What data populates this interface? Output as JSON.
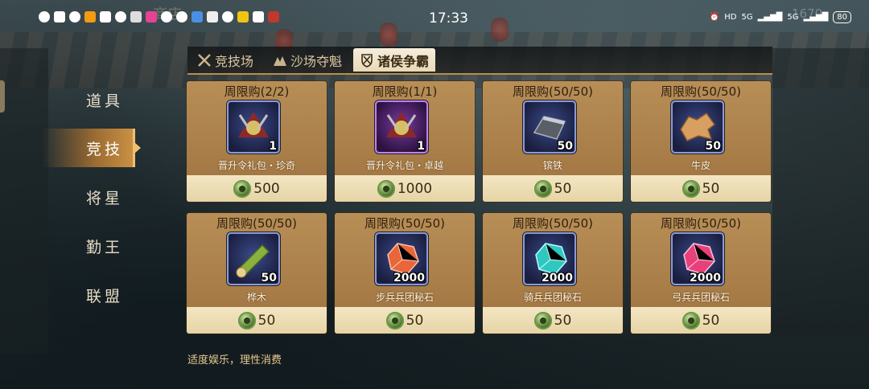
{
  "status_bar": {
    "time": "17:33",
    "battery": "80",
    "network": "5G",
    "signal_label": "HD",
    "faded_title": "商店",
    "faded_number": "1670"
  },
  "tabs": [
    {
      "label": "竞技场",
      "icon": "crossed-swords-icon",
      "active": false
    },
    {
      "label": "沙场夺魁",
      "icon": "mountain-banner-icon",
      "active": false
    },
    {
      "label": "诸侯争霸",
      "icon": "shield-swords-icon",
      "active": true
    }
  ],
  "nav": [
    {
      "label": "道具",
      "active": false
    },
    {
      "label": "竞技",
      "active": true
    },
    {
      "label": "将星",
      "active": false
    },
    {
      "label": "勤王",
      "active": false
    },
    {
      "label": "联盟",
      "active": false
    }
  ],
  "items": [
    {
      "limit": "周限购(2/2)",
      "name": "晋升令礼包・珍奇",
      "count": "1",
      "price": "500",
      "frame": "blue",
      "art": "gift-pack-icon"
    },
    {
      "limit": "周限购(1/1)",
      "name": "晋升令礼包・卓越",
      "count": "1",
      "price": "1000",
      "frame": "purple",
      "art": "gift-pack-icon"
    },
    {
      "limit": "周限购(50/50)",
      "name": "镔铁",
      "count": "50",
      "price": "50",
      "frame": "blue",
      "art": "iron-ingot-icon"
    },
    {
      "limit": "周限购(50/50)",
      "name": "牛皮",
      "count": "50",
      "price": "50",
      "frame": "blue",
      "art": "leather-hide-icon"
    },
    {
      "limit": "周限购(50/50)",
      "name": "桦木",
      "count": "50",
      "price": "50",
      "frame": "blue",
      "art": "birch-log-icon"
    },
    {
      "limit": "周限购(50/50)",
      "name": "步兵兵团秘石",
      "count": "2000",
      "price": "50",
      "frame": "blue",
      "art": "orange-gem-icon"
    },
    {
      "limit": "周限购(50/50)",
      "name": "骑兵兵团秘石",
      "count": "2000",
      "price": "50",
      "frame": "blue",
      "art": "cyan-gem-icon"
    },
    {
      "limit": "周限购(50/50)",
      "name": "弓兵兵团秘石",
      "count": "2000",
      "price": "50",
      "frame": "blue",
      "art": "pink-gem-icon"
    }
  ],
  "footer_note": "适度娱乐，理性消费",
  "colors": {
    "card": "#b88e57",
    "price_bar": "#efe0b8",
    "accent": "#f0c070"
  }
}
